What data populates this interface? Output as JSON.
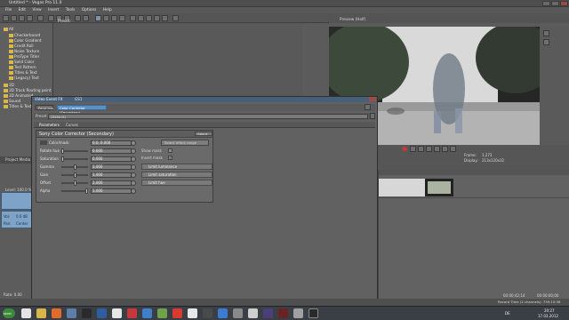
{
  "window": {
    "title": "Untitled * - Vegas Pro 11.0"
  },
  "menu": [
    "File",
    "Edit",
    "View",
    "Insert",
    "Tools",
    "Options",
    "Help"
  ],
  "explorer": {
    "root": "All",
    "items": [
      "Checkerboard",
      "Color Gradient",
      "Credit Roll",
      "Noise Texture",
      "ProType Titler",
      "Solid Color",
      "Test Pattern",
      "Titles & Text",
      "(Legacy) Text"
    ],
    "bottom_items": [
      "3D",
      "3D Track Routing point",
      "3D Animated",
      "Sound",
      "Titles & Text"
    ],
    "tab": "Project Media"
  },
  "presets_panel": {
    "header": "Preset:"
  },
  "preview": {
    "header": "Preview (Half)",
    "frame_label": "Frame:",
    "frame_value": "1,273",
    "display_label": "Display:",
    "display_value": "213x120x32"
  },
  "timeline": {
    "time_left": "00:00:42;14",
    "time_right": "00:00:00;00"
  },
  "track_left": {
    "level_label": "Level: 100.0 %",
    "rate": "Rate: 0.00",
    "vol_label": "Vol:",
    "vol_value": "0.0 dB",
    "pan_label": "Pan:",
    "pan_value": "Center"
  },
  "dialog": {
    "title": "Video Event FX",
    "title_sub": "GS1",
    "chain": [
      "Pan/Crop",
      "Color Corrector (Secondary)"
    ],
    "preset_label": "Preset:",
    "preset_value": "(Default)",
    "tabs": [
      "Parameters",
      "Curves"
    ],
    "plugin": {
      "name": "Sony Color Corrector (Secondary)",
      "about": "About",
      "select_effect": "Select effect range",
      "params": [
        {
          "label": "Color/mask",
          "value": "0.0, 0.000",
          "level": 0.0
        },
        {
          "label": "Rotate hue",
          "value": "0.000",
          "level": 0.0
        },
        {
          "label": "Saturation",
          "value": "0.000",
          "level": 0.0
        },
        {
          "label": "Gamma",
          "value": "1.000",
          "level": 0.5
        },
        {
          "label": "Gain",
          "value": "1.000",
          "level": 0.5
        },
        {
          "label": "Offset",
          "value": "1.000",
          "level": 0.5
        },
        {
          "label": "Alpha",
          "value": "1.000",
          "level": 1.0
        }
      ],
      "show_mask": "Show mask",
      "invert_mask": "Invert mask",
      "sections": [
        "Limit luminance",
        "Limit saturation",
        "Limit hue"
      ]
    }
  },
  "status": {
    "text": "Record Time (2 channels): 759:10:36"
  },
  "taskbar": {
    "start": "start",
    "lang": "DE",
    "clock_time": "20:27",
    "clock_date": "17.03.2012"
  }
}
